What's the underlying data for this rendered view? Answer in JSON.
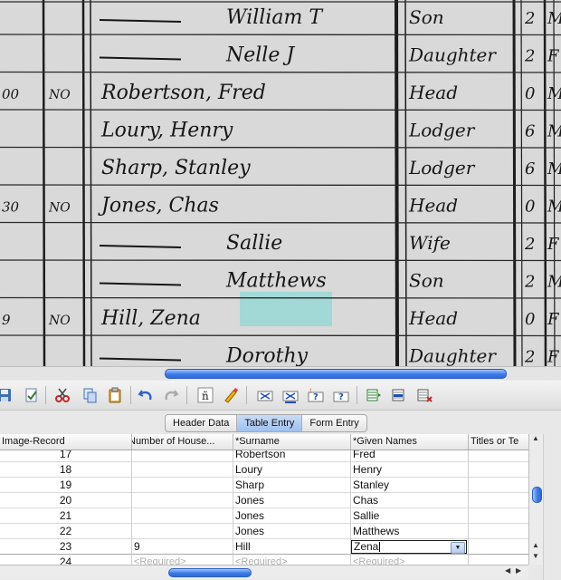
{
  "document": {
    "rows": [
      {
        "dwelling": "",
        "owned": "",
        "name": "William T",
        "relation": "Son",
        "sex": "M",
        "age": "2"
      },
      {
        "dwelling": "",
        "owned": "",
        "name": "Nelle J",
        "relation": "Daughter",
        "sex": "F",
        "age": "2"
      },
      {
        "dwelling": "00",
        "owned": "NO",
        "name": "Robertson, Fred",
        "relation": "Head",
        "sex": "M",
        "age": "0"
      },
      {
        "dwelling": "",
        "owned": "",
        "name": "Loury, Henry",
        "relation": "Lodger",
        "sex": "M",
        "age": "6"
      },
      {
        "dwelling": "",
        "owned": "",
        "name": "Sharp, Stanley",
        "relation": "Lodger",
        "sex": "M",
        "age": "6"
      },
      {
        "dwelling": "30",
        "owned": "NO",
        "name": "Jones, Chas",
        "relation": "Head",
        "sex": "M",
        "age": "0"
      },
      {
        "dwelling": "",
        "owned": "",
        "name": "Sallie",
        "relation": "Wife",
        "sex": "F",
        "age": "2"
      },
      {
        "dwelling": "",
        "owned": "",
        "name": "Matthews",
        "relation": "Son",
        "sex": "M",
        "age": "2"
      },
      {
        "dwelling": "9",
        "owned": "NO",
        "name": "Hill, Zena",
        "relation": "Head",
        "sex": "F",
        "age": "0"
      },
      {
        "dwelling": "",
        "owned": "",
        "name": "Dorothy",
        "relation": "Daughter",
        "sex": "F",
        "age": "2"
      }
    ]
  },
  "tabs": [
    {
      "label": "Header Data",
      "active": false
    },
    {
      "label": "Table Entry",
      "active": true
    },
    {
      "label": "Form Entry",
      "active": false
    }
  ],
  "table": {
    "columns": [
      "Image-Record",
      "Number of House...",
      "*Surname",
      "*Given Names",
      "Titles or Te"
    ],
    "rows": [
      {
        "record": "17",
        "house": "",
        "surname": "Robertson",
        "given": "Fred",
        "titles": ""
      },
      {
        "record": "18",
        "house": "",
        "surname": "Loury",
        "given": "Henry",
        "titles": ""
      },
      {
        "record": "19",
        "house": "",
        "surname": "Sharp",
        "given": "Stanley",
        "titles": ""
      },
      {
        "record": "20",
        "house": "",
        "surname": "Jones",
        "given": "Chas",
        "titles": ""
      },
      {
        "record": "21",
        "house": "",
        "surname": "Jones",
        "given": "Sallie",
        "titles": ""
      },
      {
        "record": "22",
        "house": "",
        "surname": "Jones",
        "given": "Matthews",
        "titles": ""
      },
      {
        "record": "23",
        "house": "9",
        "surname": "Hill",
        "given": "Zena",
        "titles": ""
      },
      {
        "record": "24",
        "house": "<Required>",
        "surname": "<Required>",
        "given": "<Required>",
        "titles": ""
      }
    ],
    "active_row": 6,
    "active_value": "Zena"
  },
  "colors": {
    "highlight": "#8fd8d4",
    "accent": "#3b7be8",
    "tab_active": "#a9c6f0"
  }
}
